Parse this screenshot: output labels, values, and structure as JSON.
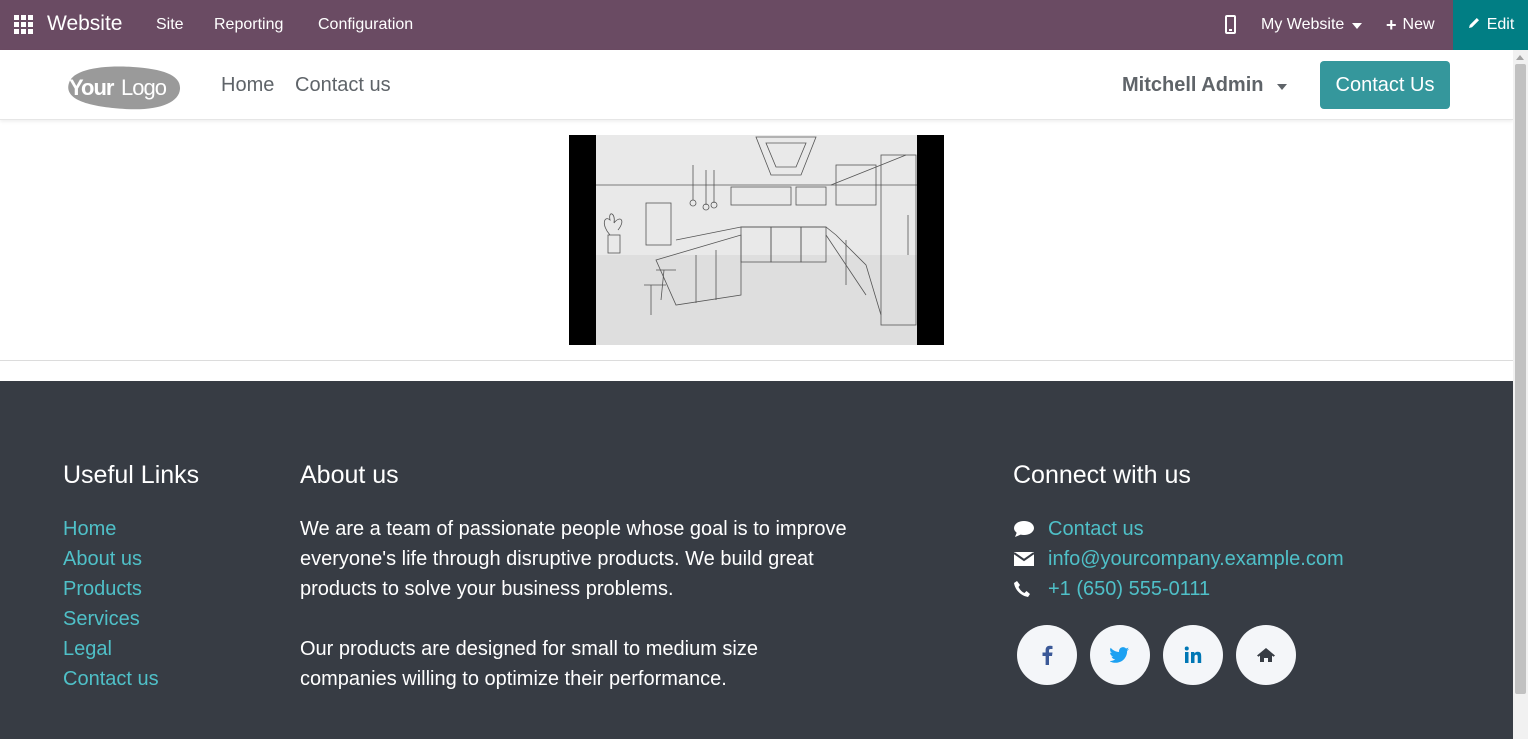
{
  "admin_bar": {
    "brand": "Website",
    "menus": [
      "Site",
      "Reporting",
      "Configuration"
    ],
    "website_selector": "My Website",
    "new_label": "New",
    "edit_label": "Edit",
    "bg_color": "#6a4b63",
    "edit_color": "#017e84"
  },
  "header": {
    "logo_text": "Your Logo",
    "nav": [
      "Home",
      "Contact us"
    ],
    "user_name": "Mitchell Admin",
    "cta_label": "Contact Us",
    "cta_color": "#35979c"
  },
  "main": {
    "video": {
      "description": "kitchen-perspective-sketch"
    }
  },
  "footer": {
    "bg_color": "#373c44",
    "link_color": "#4fc0c8",
    "useful_links": {
      "title": "Useful Links",
      "items": [
        "Home",
        "About us",
        "Products",
        "Services",
        "Legal",
        "Contact us"
      ]
    },
    "about": {
      "title": "About us",
      "paragraphs": [
        "We are a team of passionate people whose goal is to improve everyone's life through disruptive products. We build great products to solve your business problems.",
        "Our products are designed for small to medium size companies willing to optimize their performance."
      ]
    },
    "connect": {
      "title": "Connect with us",
      "items": [
        {
          "icon": "comment-icon",
          "text": "Contact us"
        },
        {
          "icon": "envelope-icon",
          "text": "info@yourcompany.example.com"
        },
        {
          "icon": "phone-icon",
          "text": "+1 (650) 555-0111"
        }
      ],
      "social": [
        "facebook-icon",
        "twitter-icon",
        "linkedin-icon",
        "home-icon"
      ]
    }
  }
}
